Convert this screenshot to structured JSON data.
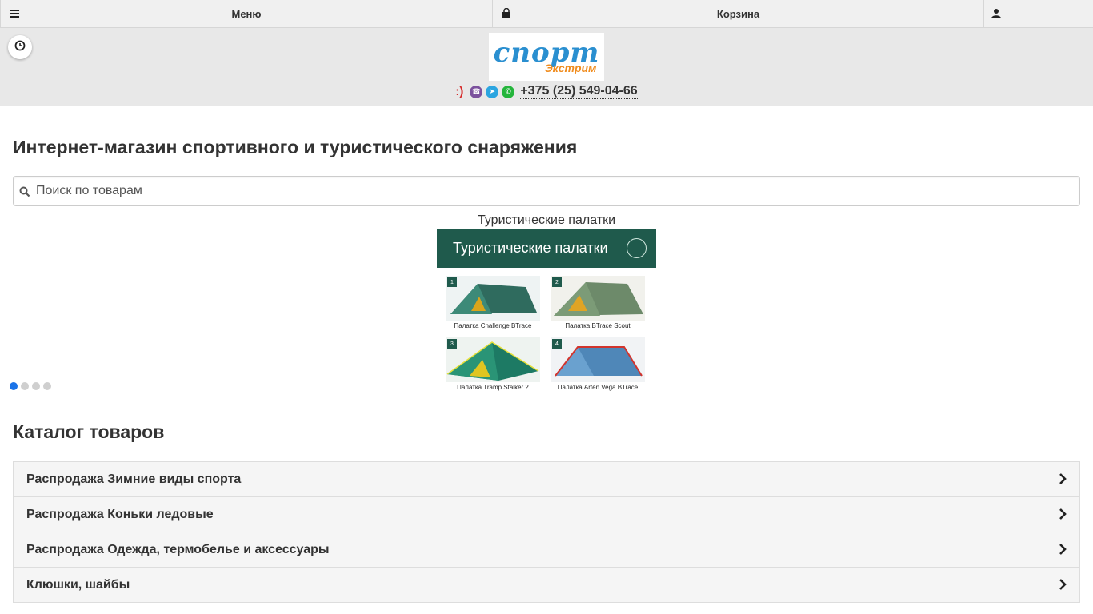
{
  "topbar": {
    "menu_label": "Меню",
    "cart_label": "Корзина"
  },
  "header": {
    "logo_text_main": "спорт",
    "logo_text_sub": "Экстрим",
    "smile": ":)",
    "phone": "+375 (25) 549-04-66"
  },
  "main": {
    "title": "Интернет-магазин спортивного и туристического снаряжения",
    "search_placeholder": "Поиск по товарам",
    "slider": {
      "caption": "Туристические палатки",
      "banner_title": "Туристические палатки",
      "items": [
        {
          "num": "1",
          "label": "Палатка Challenge BTrace"
        },
        {
          "num": "2",
          "label": "Палатка BTrace Scout"
        },
        {
          "num": "3",
          "label": "Палатка Tramp Stalker 2"
        },
        {
          "num": "4",
          "label": "Палатка Arten Vega BTrace"
        }
      ],
      "active_slide": 1,
      "slide_count": 4
    },
    "catalog_title": "Каталог товаров",
    "catalog_items": [
      {
        "label": "Распродажа Зимние виды спорта"
      },
      {
        "label": "Распродажа Коньки ледовые"
      },
      {
        "label": "Распродажа Одежда, термобелье и аксессуары"
      },
      {
        "label": "Клюшки, шайбы"
      }
    ]
  },
  "colors": {
    "accent": "#1a73e8",
    "banner_green": "#1f5a4c",
    "logo_blue": "#2a8fd0",
    "logo_orange": "#f08c1e"
  },
  "icons": [
    "menu-icon",
    "bag-icon",
    "user-icon",
    "clock-icon",
    "viber-icon",
    "telegram-icon",
    "whatsapp-icon",
    "search-icon",
    "chevron-right-icon"
  ]
}
